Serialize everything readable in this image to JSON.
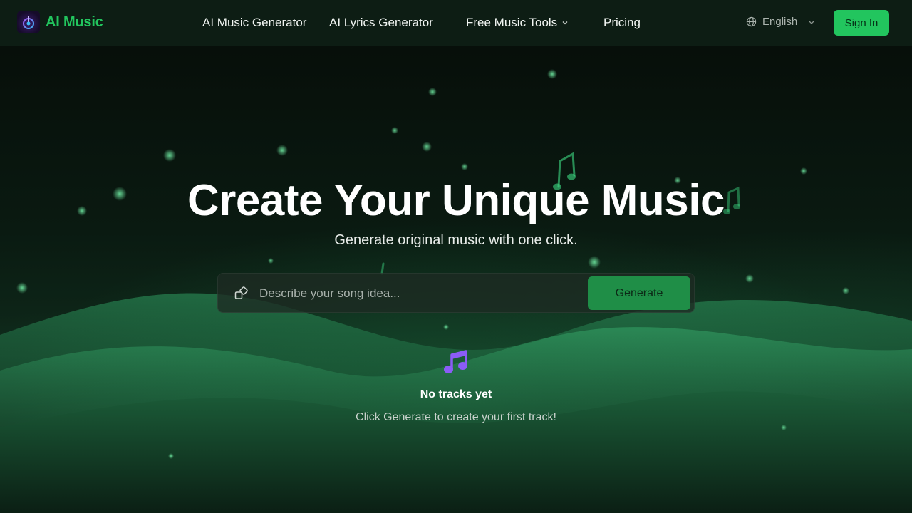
{
  "header": {
    "brand_name": "AI Music",
    "nav": {
      "music_generator": "AI Music Generator",
      "lyrics_generator": "AI Lyrics Generator",
      "free_tools": "Free Music Tools",
      "pricing": "Pricing"
    },
    "language": "English",
    "sign_in": "Sign In"
  },
  "hero": {
    "title": "Create Your Unique Music",
    "subtitle": "Generate original music with one click."
  },
  "prompt": {
    "placeholder": "Describe your song idea...",
    "value": "",
    "generate_label": "Generate"
  },
  "empty_state": {
    "icon": "music-notes-icon",
    "title": "No tracks yet",
    "hint": "Click Generate to create your first track!"
  },
  "colors": {
    "brand_green": "#22c55e",
    "generate_green": "#1f8e47",
    "empty_icon_purple": "#8b5cf6"
  }
}
